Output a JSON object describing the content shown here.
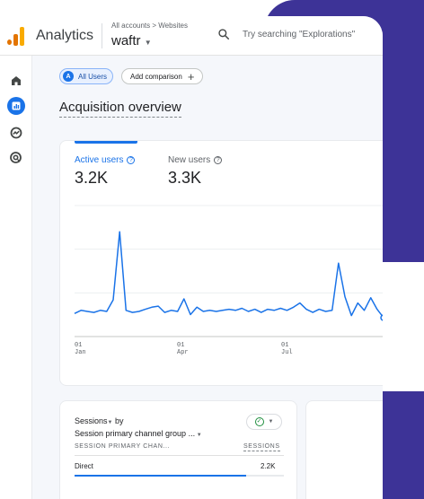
{
  "topbar": {
    "app_name": "Analytics",
    "breadcrumb": "All accounts > Websites",
    "property_name": "waftr",
    "search_placeholder": "Try searching \"Explorations\""
  },
  "rail": {
    "icons": [
      "home-icon",
      "reports-icon",
      "explore-icon",
      "advertising-icon"
    ],
    "active_index": 1
  },
  "filters": {
    "segment_badge": "A",
    "segment_label": "All Users",
    "compare_label": "Add comparison"
  },
  "page_title": "Acquisition overview",
  "metrics": [
    {
      "label": "Active users",
      "value": "3.2K",
      "selected": true
    },
    {
      "label": "New users",
      "value": "3.3K",
      "selected": false
    }
  ],
  "chart_data": {
    "type": "line",
    "x_ticks": [
      {
        "day": "01",
        "month": "Jan"
      },
      {
        "day": "01",
        "month": "Apr"
      },
      {
        "day": "01",
        "month": "Jul"
      }
    ],
    "series": [
      {
        "values": [
          22,
          25,
          24,
          23,
          25,
          24,
          35,
          100,
          25,
          23,
          24,
          26,
          28,
          29,
          23,
          25,
          24,
          36,
          21,
          28,
          24,
          25,
          24,
          25,
          26,
          25,
          27,
          24,
          26,
          23,
          26,
          25,
          27,
          25,
          28,
          32,
          26,
          23,
          26,
          24,
          25,
          70,
          38,
          20,
          32,
          25,
          37,
          26,
          18
        ]
      }
    ],
    "ylim": [
      0,
      125
    ],
    "color": "#1a73e8",
    "grid": true
  },
  "sessions_card": {
    "title_line1": "Sessions",
    "by": "by",
    "title_line2": "Session primary channel group ...",
    "col_dimension": "SESSION PRIMARY CHAN...",
    "col_metric": "SESSIONS",
    "rows": [
      {
        "label": "Direct",
        "value": "2.2K",
        "share": 0.82
      }
    ]
  },
  "colors": {
    "accent": "#1a73e8",
    "decor": "#3d3397"
  }
}
